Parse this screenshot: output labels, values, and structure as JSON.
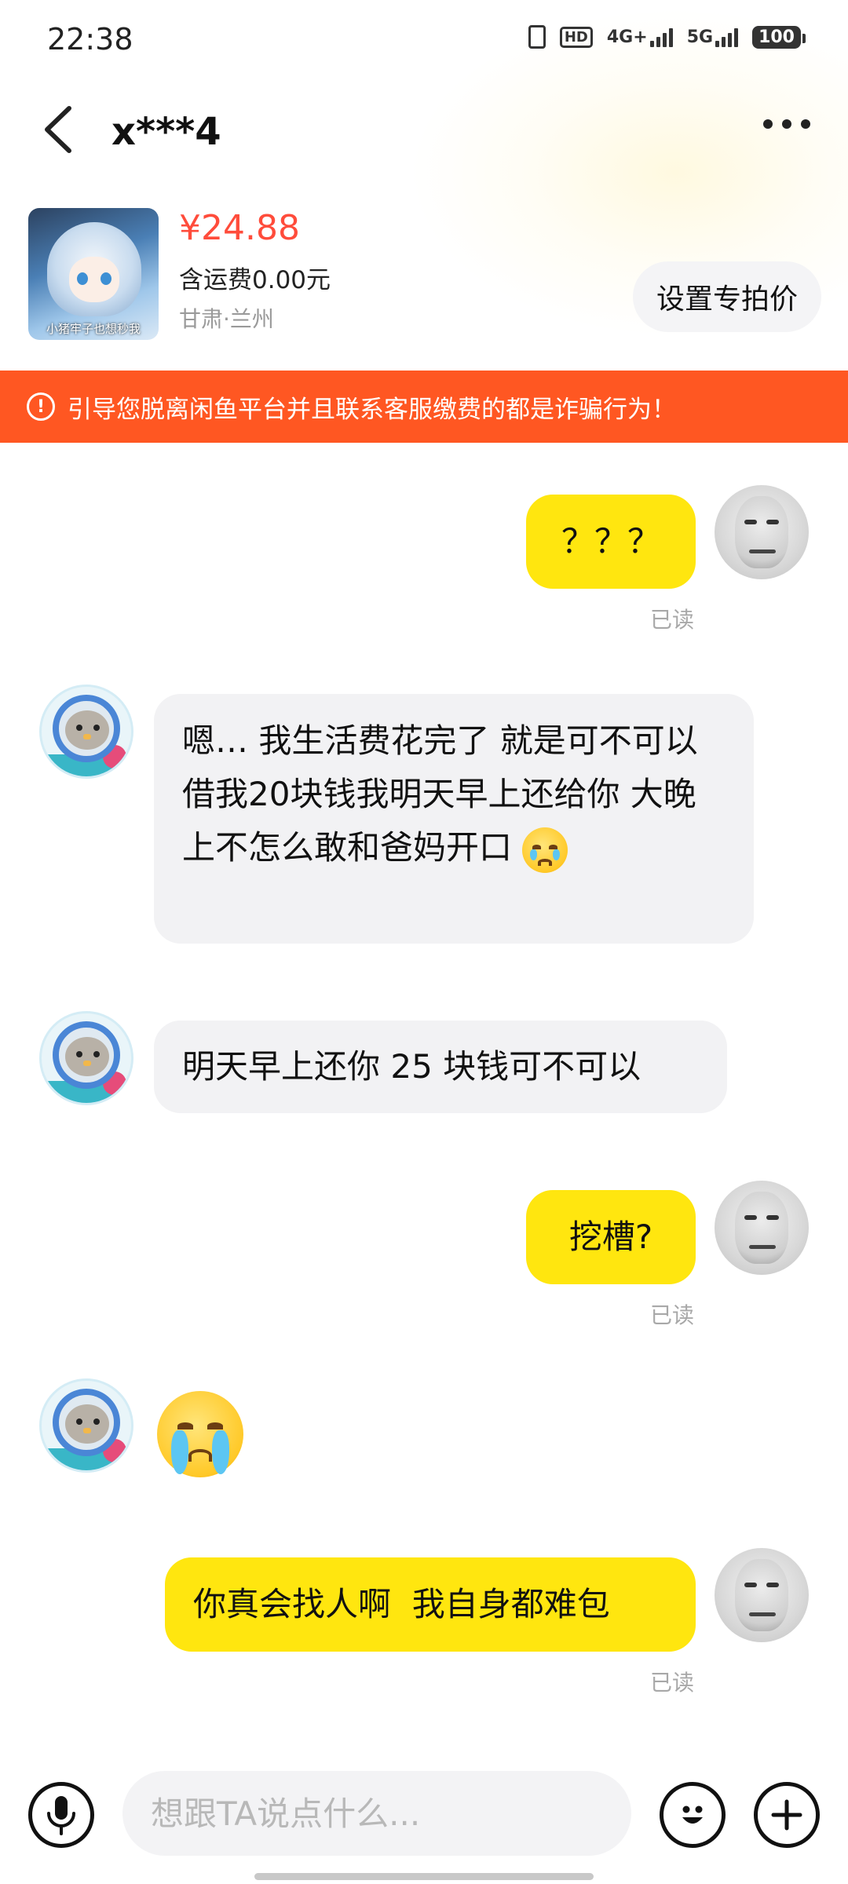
{
  "status_bar": {
    "time": "22:38",
    "hd": "HD",
    "network_4g": "4G+",
    "network_5g": "5G",
    "battery": "100"
  },
  "nav": {
    "title": "x***4"
  },
  "product": {
    "price": "¥24.88",
    "shipping": "含运费0.00元",
    "location": "甘肃·兰州",
    "thumb_caption": "小猪牢子也想秒我",
    "set_price_label": "设置专拍价"
  },
  "warning": {
    "icon": "!",
    "text": "引导您脱离闲鱼平台并且联系客服缴费的都是诈骗行为！"
  },
  "messages": [
    {
      "from": "me",
      "text": "？？？",
      "status": "已读"
    },
    {
      "from": "other",
      "text": "嗯… 我生活费花完了 就是可不可以借我20块钱我明天早上还给你 大晚上不怎么敢和爸妈开口",
      "emoji": "crying-face"
    },
    {
      "from": "other",
      "text": "明天早上还你 25 块钱可不可以"
    },
    {
      "from": "me",
      "text": "挖槽?",
      "status": "已读"
    },
    {
      "from": "other",
      "emoji": "loudly-crying-face"
    },
    {
      "from": "me",
      "text": "你真会找人啊  我自身都难包",
      "status": "已读"
    }
  ],
  "input": {
    "placeholder": "想跟TA说点什么..."
  },
  "colors": {
    "accent_yellow": "#ffe60f",
    "price_red": "#ff4c3b",
    "warning_orange": "#ff5722",
    "other_bubble": "#f2f2f4"
  }
}
